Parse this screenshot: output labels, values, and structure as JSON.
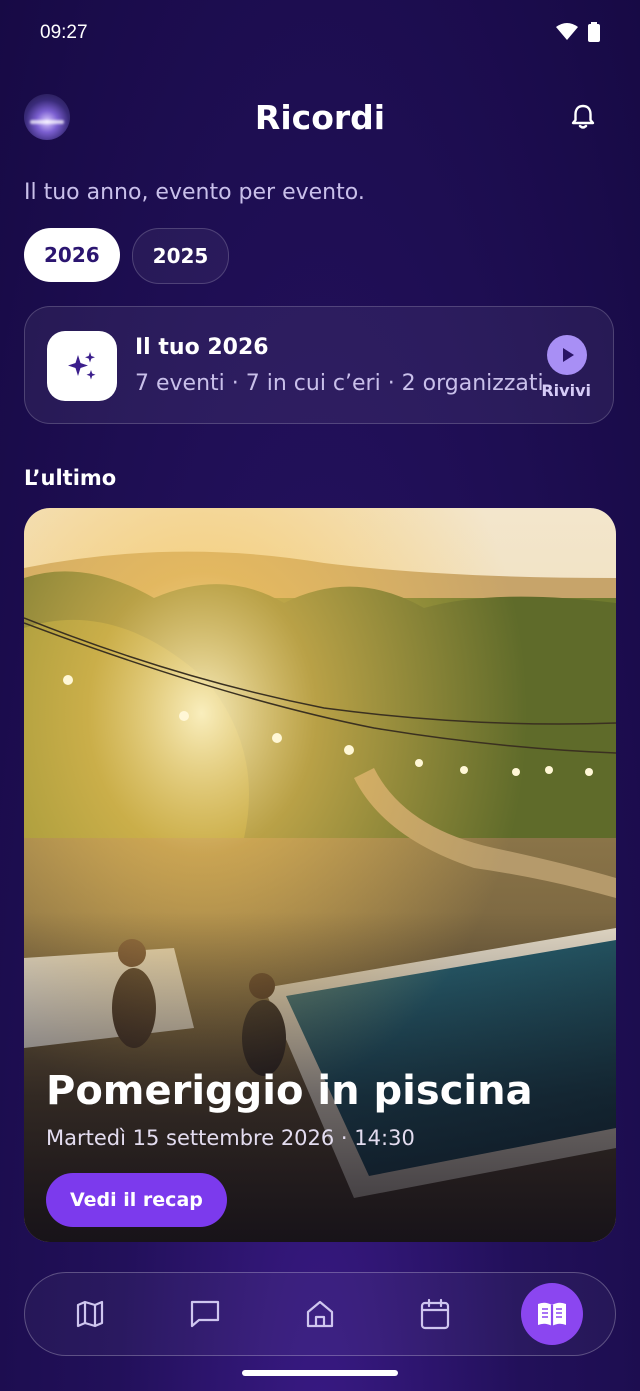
{
  "status_bar": {
    "time": "09:27"
  },
  "header": {
    "title": "Ricordi"
  },
  "subtitle": "Il tuo anno, evento per evento.",
  "year_tabs": [
    {
      "label": "2026",
      "selected": true
    },
    {
      "label": "2025",
      "selected": false
    }
  ],
  "recap": {
    "title": "Il tuo 2026",
    "stats": "7 eventi · 7 in cui c’eri · 2 organizzati",
    "play_label": "Rivivi"
  },
  "latest": {
    "section_label": "L’ultimo",
    "event_title": "Pomeriggio in piscina",
    "event_date": "Martedì 15 settembre 2026 · 14:30",
    "button_label": "Vedi il recap"
  },
  "nav": {
    "items": [
      {
        "icon": "map-icon",
        "active": false
      },
      {
        "icon": "chat-icon",
        "active": false
      },
      {
        "icon": "home-icon",
        "active": false
      },
      {
        "icon": "calendar-icon",
        "active": false
      },
      {
        "icon": "book-icon",
        "active": true
      }
    ]
  },
  "colors": {
    "accent": "#7c3aed",
    "background": "#1c0c50",
    "active_nav": "#8b46f0"
  }
}
